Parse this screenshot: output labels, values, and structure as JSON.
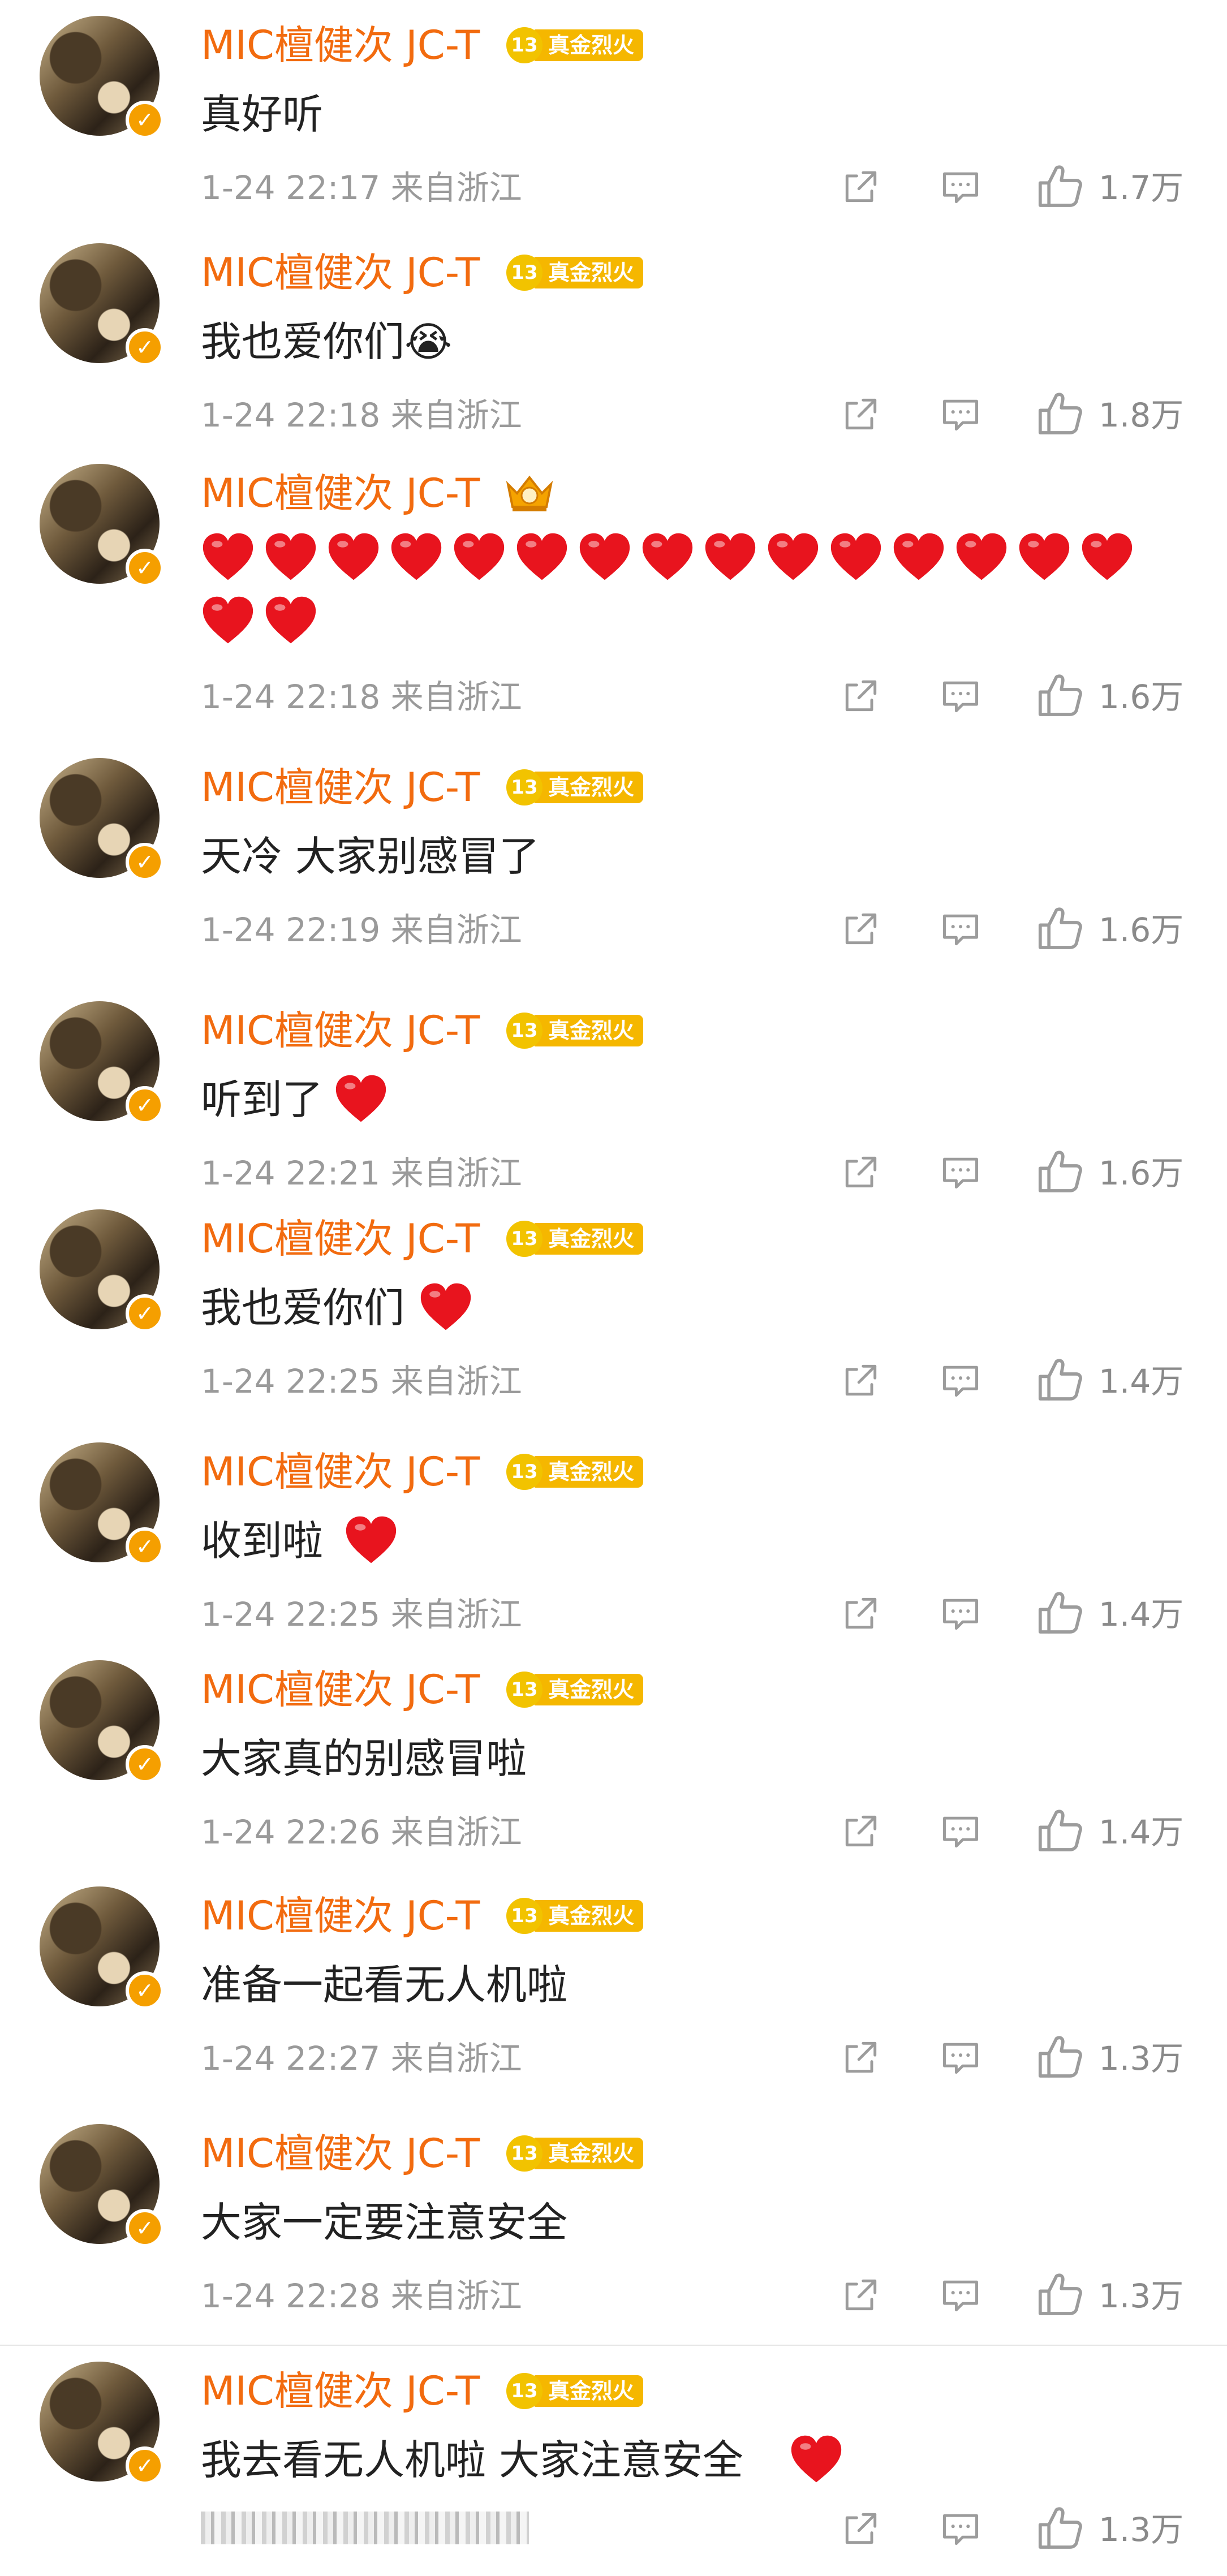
{
  "comments": [
    {
      "user": "MIC檀健次 JC-T",
      "badge_level": "13",
      "badge_text": "真金烈火",
      "text": "真好听",
      "time": "1-24 22:17",
      "location": "来自浙江",
      "likes": "1.7万"
    },
    {
      "user": "MIC檀健次 JC-T",
      "badge_level": "13",
      "badge_text": "真金烈火",
      "text": "我也爱你们😭",
      "time": "1-24 22:18",
      "location": "来自浙江",
      "likes": "1.8万"
    },
    {
      "user": "MIC檀健次 JC-T",
      "badge": "crown-icon",
      "hearts": 17,
      "time": "1-24 22:18",
      "location": "来自浙江",
      "likes": "1.6万"
    },
    {
      "user": "MIC檀健次 JC-T",
      "badge_level": "13",
      "badge_text": "真金烈火",
      "text": "天冷 大家别感冒了",
      "time": "1-24 22:19",
      "location": "来自浙江",
      "likes": "1.6万"
    },
    {
      "user": "MIC檀健次 JC-T",
      "badge_level": "13",
      "badge_text": "真金烈火",
      "text": "听到了",
      "heart": true,
      "time": "1-24 22:21",
      "location": "来自浙江",
      "likes": "1.6万"
    },
    {
      "user": "MIC檀健次 JC-T",
      "badge_level": "13",
      "badge_text": "真金烈火",
      "text": "我也爱你们",
      "heart": true,
      "time": "1-24 22:25",
      "location": "来自浙江",
      "likes": "1.4万"
    },
    {
      "user": "MIC檀健次 JC-T",
      "badge_level": "13",
      "badge_text": "真金烈火",
      "text": "收到啦",
      "heart": true,
      "time": "1-24 22:25",
      "location": "来自浙江",
      "likes": "1.4万"
    },
    {
      "user": "MIC檀健次 JC-T",
      "badge_level": "13",
      "badge_text": "真金烈火",
      "text": "大家真的别感冒啦",
      "time": "1-24 22:26",
      "location": "来自浙江",
      "likes": "1.4万"
    },
    {
      "user": "MIC檀健次 JC-T",
      "badge_level": "13",
      "badge_text": "真金烈火",
      "text": "准备一起看无人机啦",
      "time": "1-24 22:27",
      "location": "来自浙江",
      "likes": "1.3万"
    },
    {
      "user": "MIC檀健次 JC-T",
      "badge_level": "13",
      "badge_text": "真金烈火",
      "text": "大家一定要注意安全",
      "time": "1-24 22:28",
      "location": "来自浙江",
      "likes": "1.3万"
    },
    {
      "user": "MIC檀健次 JC-T",
      "badge_level": "13",
      "badge_text": "真金烈火",
      "text": "我去看无人机啦 大家注意安全",
      "heart": true,
      "likes": "1.3万"
    }
  ],
  "colors": {
    "username": "#f26b0f",
    "badge": "#f5b700",
    "heart": "#e8141e",
    "meta": "#9a9a9a"
  },
  "icons": [
    "share-icon",
    "comment-icon",
    "like-icon",
    "verified-badge-icon",
    "heart-icon",
    "crown-icon"
  ]
}
